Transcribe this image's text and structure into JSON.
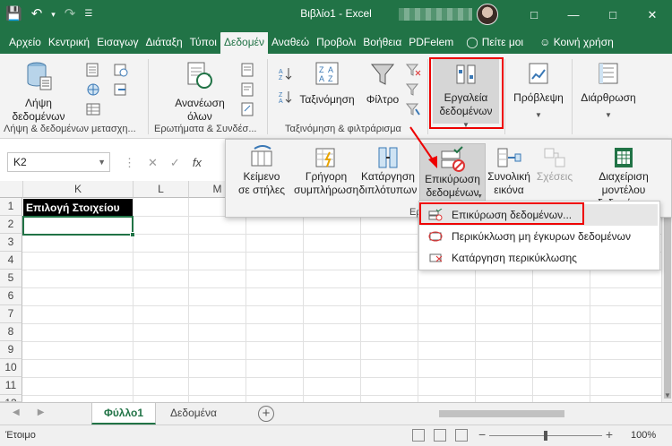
{
  "titlebar": {
    "title": "Βιβλίο1 - Excel",
    "bg": "#217346"
  },
  "tabs": [
    {
      "label": "Αρχείο"
    },
    {
      "label": "Κεντρική"
    },
    {
      "label": "Εισαγωγ"
    },
    {
      "label": "Διάταξη"
    },
    {
      "label": "Τύποι"
    },
    {
      "label": "Δεδομέν"
    },
    {
      "label": "Αναθεώ"
    },
    {
      "label": "Προβολι"
    },
    {
      "label": "Βοήθεια"
    },
    {
      "label": "PDFelem"
    }
  ],
  "tell_me": "Πείτε μοι",
  "share": "Κοινή χρήση",
  "ribbon": {
    "get_data": "Λήψη\nδεδομένων",
    "group_get": "Λήψη & δεδομένων μετασχη...",
    "refresh": "Ανανέωση\nόλων",
    "group_queries": "Ερωτήματα & Συνδέσ...",
    "sort": "Ταξινόμηση",
    "filter": "Φίλτρο",
    "group_sort": "Ταξινόμηση & φιλτράρισμα",
    "data_tools": "Εργαλεία\nδεδομένων",
    "forecast": "Πρόβλεψη",
    "outline": "Διάρθρωση"
  },
  "formula_bar": {
    "namebox": "K2",
    "fx": "fx"
  },
  "grid": {
    "columns": [
      "K",
      "L",
      "M"
    ],
    "rows": [
      "1",
      "2",
      "3",
      "4",
      "5",
      "6",
      "7",
      "8",
      "9",
      "10",
      "11",
      "12"
    ],
    "header_cell": "Επιλογή Στοιχείου"
  },
  "flyout": {
    "text_to_columns": "Κείμενο\nσε στήλες",
    "flash_fill": "Γρήγορη\nσυμπλήρωση",
    "remove_dupes": "Κατάργηση\nδιπλότυπων",
    "validation": "Επικύρωση\nδεδομένων",
    "consolidate": "Συνολική\nεικόνα",
    "relationships": "Σχέσεις",
    "data_model": "Διαχείριση μοντέλου\nδεδομένων",
    "group_label": "Εργ"
  },
  "menu": {
    "items": [
      {
        "label": "Επικύρωση δεδομένων..."
      },
      {
        "label": "Περικύκλωση μη έγκυρων δεδομένων"
      },
      {
        "label": "Κατάργηση περικύκλωσης"
      }
    ]
  },
  "sheets": [
    {
      "label": "Φύλλο1"
    },
    {
      "label": "Δεδομένα"
    }
  ],
  "status": {
    "ready": "Έτοιμο",
    "zoom": "100%"
  }
}
